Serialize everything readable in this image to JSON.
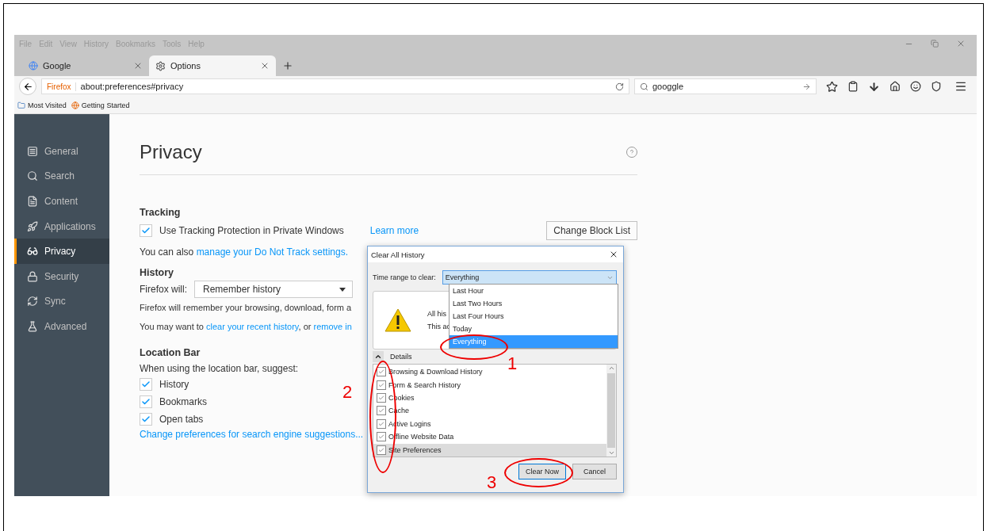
{
  "menu_bar": {
    "items": [
      "File",
      "Edit",
      "View",
      "History",
      "Bookmarks",
      "Tools",
      "Help"
    ]
  },
  "tabs": [
    {
      "label": "Google",
      "selected": false,
      "kind": "google"
    },
    {
      "label": "Options",
      "selected": true,
      "kind": "gear"
    }
  ],
  "nav_bar": {
    "identity": "Firefox",
    "url": "about:preferences#privacy",
    "search_value": "googgle"
  },
  "bookmarks_bar": {
    "items": [
      {
        "label": "Most Visited",
        "kind": "folder"
      },
      {
        "label": "Getting Started",
        "kind": "firefox"
      }
    ]
  },
  "sidebar": {
    "items": [
      {
        "label": "General",
        "kind": "general",
        "selected": false
      },
      {
        "label": "Search",
        "kind": "search",
        "selected": false
      },
      {
        "label": "Content",
        "kind": "content",
        "selected": false
      },
      {
        "label": "Applications",
        "kind": "applications",
        "selected": false
      },
      {
        "label": "Privacy",
        "kind": "privacy",
        "selected": true
      },
      {
        "label": "Security",
        "kind": "security",
        "selected": false
      },
      {
        "label": "Sync",
        "kind": "sync",
        "selected": false
      },
      {
        "label": "Advanced",
        "kind": "advanced",
        "selected": false
      }
    ]
  },
  "page": {
    "title": "Privacy",
    "tracking": {
      "heading": "Tracking",
      "checkbox_label": "Use Tracking Protection in Private Windows",
      "checked": true,
      "learn_more": "Learn more",
      "button": "Change Block List",
      "note_prefix": "You can also ",
      "note_link": "manage your Do Not Track settings."
    },
    "history": {
      "heading": "History",
      "will_label": "Firefox will:",
      "select_value": "Remember history",
      "description": "Firefox will remember your browsing, download, form a",
      "hint_prefix": "You may want to ",
      "hint_link_1": "clear your recent history",
      "hint_middle": ", or ",
      "hint_link_2": "remove in"
    },
    "location_bar": {
      "heading": "Location Bar",
      "intro": "When using the location bar, suggest:",
      "options": [
        {
          "label": "History",
          "checked": true
        },
        {
          "label": "Bookmarks",
          "checked": true
        },
        {
          "label": "Open tabs",
          "checked": true
        }
      ],
      "link": "Change preferences for search engine suggestions..."
    }
  },
  "dialog": {
    "title": "Clear All History",
    "range_label": "Time range to clear:",
    "range_value": "Everything",
    "range_options": [
      {
        "label": "Last Hour",
        "selected": false
      },
      {
        "label": "Last Two Hours",
        "selected": false
      },
      {
        "label": "Last Four Hours",
        "selected": false
      },
      {
        "label": "Today",
        "selected": false
      },
      {
        "label": "Everything",
        "selected": true
      }
    ],
    "warning_lines": [
      "All his",
      "This ac"
    ],
    "details_label": "Details",
    "items": [
      {
        "label": "Browsing & Download History",
        "checked": true,
        "selected": false
      },
      {
        "label": "Form & Search History",
        "checked": true,
        "selected": false
      },
      {
        "label": "Cookies",
        "checked": true,
        "selected": false
      },
      {
        "label": "Cache",
        "checked": true,
        "selected": false
      },
      {
        "label": "Active Logins",
        "checked": true,
        "selected": false
      },
      {
        "label": "Offline Website Data",
        "checked": true,
        "selected": false
      },
      {
        "label": "Site Preferences",
        "checked": true,
        "selected": true
      }
    ],
    "buttons": [
      {
        "label": "Clear Now",
        "default": true
      },
      {
        "label": "Cancel",
        "default": false
      }
    ]
  },
  "annotations": [
    {
      "label": "1"
    },
    {
      "label": "2"
    },
    {
      "label": "3"
    }
  ]
}
